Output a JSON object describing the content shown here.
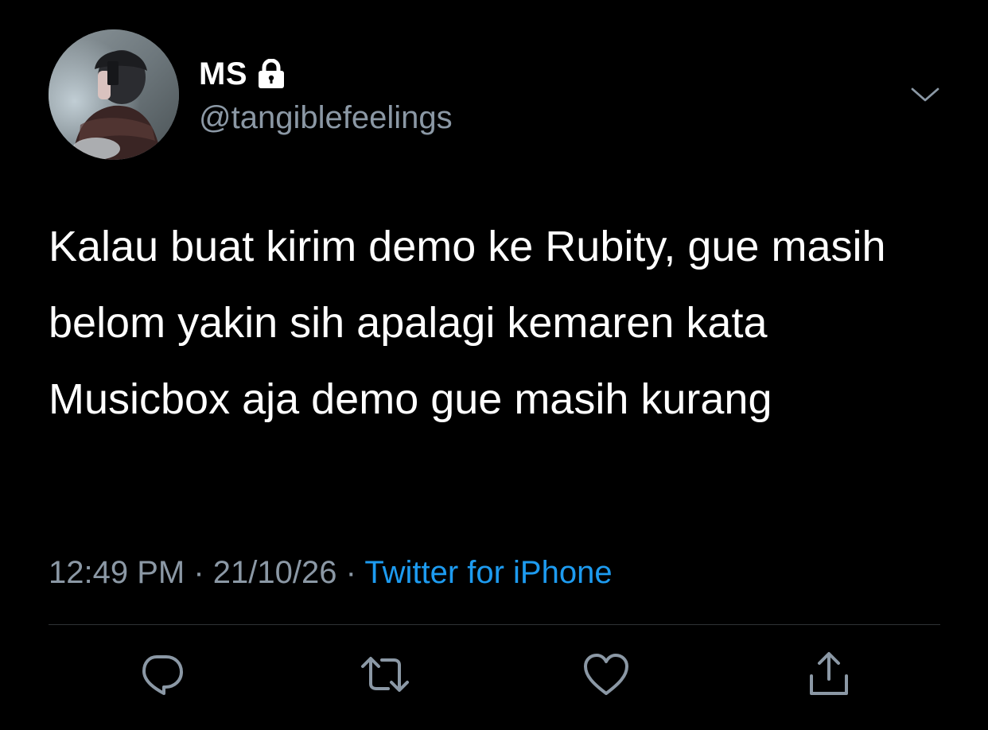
{
  "tweet": {
    "display_name": "MS",
    "protected_icon": "lock-icon",
    "handle": "@tangiblefeelings",
    "text": "Kalau buat kirim demo ke Rubity, gue masih belom yakin sih apalagi kemaren kata Musicbox aja demo gue masih kurang",
    "time": "12:49 PM",
    "separator": "·",
    "date": "21/10/26",
    "source": "Twitter for iPhone"
  },
  "icons": {
    "more": "chevron-down-icon",
    "reply": "reply-icon",
    "retweet": "retweet-icon",
    "like": "heart-icon",
    "share": "share-icon"
  },
  "colors": {
    "background": "#000000",
    "text_primary": "#ffffff",
    "text_secondary": "#8b98a5",
    "link": "#1d9bf0",
    "divider": "#2f3336"
  }
}
